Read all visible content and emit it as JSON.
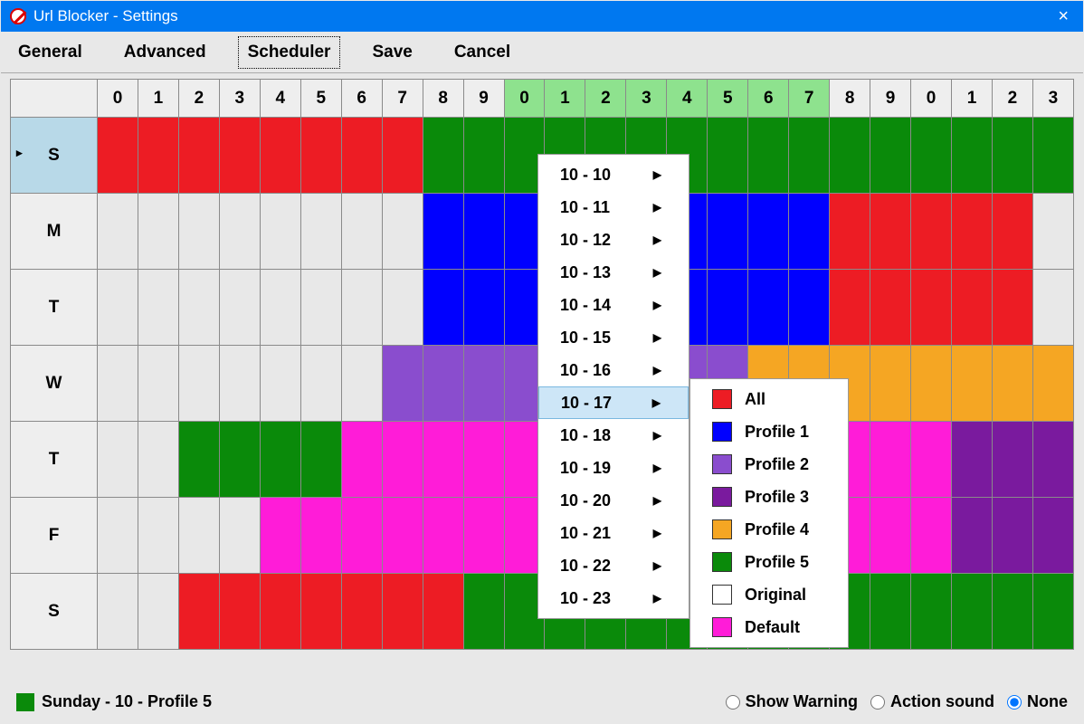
{
  "window": {
    "title": "Url Blocker - Settings"
  },
  "toolbar": {
    "general": "General",
    "advanced": "Advanced",
    "scheduler": "Scheduler",
    "save": "Save",
    "cancel": "Cancel"
  },
  "hours": [
    "0",
    "1",
    "2",
    "3",
    "4",
    "5",
    "6",
    "7",
    "8",
    "9",
    "0",
    "1",
    "2",
    "3",
    "4",
    "5",
    "6",
    "7",
    "8",
    "9",
    "0",
    "1",
    "2",
    "3"
  ],
  "day_hours": [
    10,
    11,
    12,
    13,
    14,
    15,
    16,
    17
  ],
  "days": [
    "S",
    "M",
    "T",
    "W",
    "T",
    "F",
    "S"
  ],
  "colors": {
    "all": "#ed1c24",
    "p1": "#0000ff",
    "p2": "#8a4dce",
    "p3": "#7a1a9e",
    "p4": "#f5a623",
    "p5": "#0a8a0a",
    "orig": "#ffffff",
    "def": "#ff1cd8",
    "none": "#e8e8e8"
  },
  "grid": [
    [
      "all",
      "all",
      "all",
      "all",
      "all",
      "all",
      "all",
      "all",
      "p5",
      "p5",
      "p5",
      "p5",
      "p5",
      "p5",
      "p5",
      "p5",
      "p5",
      "p5",
      "p5",
      "p5",
      "p5",
      "p5",
      "p5",
      "p5"
    ],
    [
      "none",
      "none",
      "none",
      "none",
      "none",
      "none",
      "none",
      "none",
      "p1",
      "p1",
      "p1",
      "p1",
      "p1",
      "p1",
      "p1",
      "p1",
      "p1",
      "p1",
      "all",
      "all",
      "all",
      "all",
      "all",
      "none"
    ],
    [
      "none",
      "none",
      "none",
      "none",
      "none",
      "none",
      "none",
      "none",
      "p1",
      "p1",
      "p1",
      "p1",
      "p1",
      "p1",
      "p1",
      "p1",
      "p1",
      "p1",
      "all",
      "all",
      "all",
      "all",
      "all",
      "none"
    ],
    [
      "none",
      "none",
      "none",
      "none",
      "none",
      "none",
      "none",
      "p2",
      "p2",
      "p2",
      "p2",
      "p2",
      "p2",
      "p2",
      "p2",
      "p2",
      "p4",
      "p4",
      "p4",
      "p4",
      "p4",
      "p4",
      "p4",
      "p4"
    ],
    [
      "none",
      "none",
      "p5",
      "p5",
      "p5",
      "p5",
      "def",
      "def",
      "def",
      "def",
      "def",
      "def",
      "def",
      "def",
      "def",
      "def",
      "def",
      "def",
      "def",
      "def",
      "def",
      "p3",
      "p3",
      "p3",
      "p3"
    ],
    [
      "none",
      "none",
      "none",
      "none",
      "def",
      "def",
      "def",
      "def",
      "def",
      "def",
      "def",
      "def",
      "def",
      "def",
      "def",
      "def",
      "def",
      "def",
      "def",
      "def",
      "def",
      "p3",
      "p3",
      "p3",
      "p3"
    ],
    [
      "none",
      "none",
      "all",
      "all",
      "all",
      "all",
      "all",
      "all",
      "all",
      "p5",
      "p5",
      "p5",
      "p5",
      "p5",
      "p5",
      "p5",
      "p5",
      "p5",
      "p5",
      "p5",
      "p5",
      "p5",
      "p5",
      "p5"
    ]
  ],
  "context_menu": {
    "items": [
      "10 - 10",
      "10 - 11",
      "10 - 12",
      "10 - 13",
      "10 - 14",
      "10 - 15",
      "10 - 16",
      "10 - 17",
      "10 - 18",
      "10 - 19",
      "10 - 20",
      "10 - 21",
      "10 - 22",
      "10 - 23"
    ],
    "highlighted": "10 - 17"
  },
  "sub_menu": {
    "items": [
      {
        "label": "All",
        "color": "#ed1c24"
      },
      {
        "label": "Profile 1",
        "color": "#0000ff"
      },
      {
        "label": "Profile 2",
        "color": "#8a4dce"
      },
      {
        "label": "Profile 3",
        "color": "#7a1a9e"
      },
      {
        "label": "Profile 4",
        "color": "#f5a623"
      },
      {
        "label": "Profile 5",
        "color": "#0a8a0a"
      },
      {
        "label": "Original",
        "color": "#ffffff"
      },
      {
        "label": "Default",
        "color": "#ff1cd8"
      }
    ]
  },
  "status": {
    "swatch": "#0a8a0a",
    "text": "Sunday - 10 - Profile 5",
    "opt_warn": "Show Warning",
    "opt_sound": "Action sound",
    "opt_none": "None",
    "selected": "None"
  }
}
